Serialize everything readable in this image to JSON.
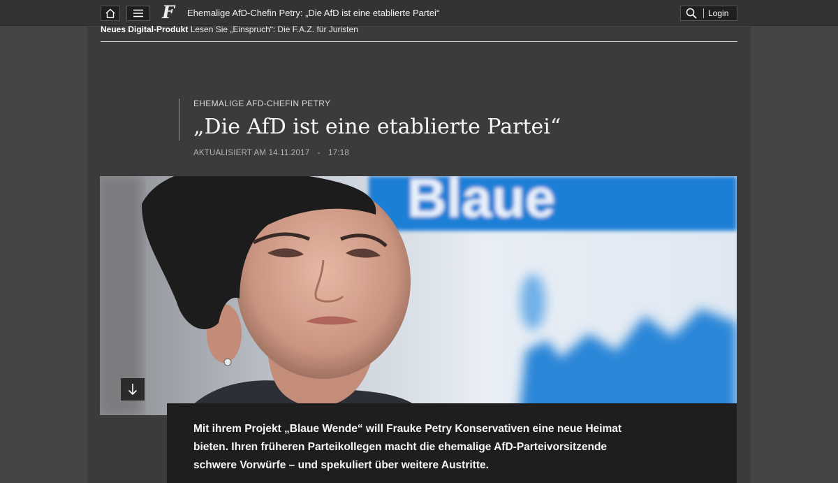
{
  "topbar": {
    "home_icon": "home-icon",
    "menu_icon": "menu-icon",
    "logo_text": "F",
    "title": "Ehemalige AfD-Chefin Petry: „Die AfD ist eine etablierte Partei“",
    "search_icon": "search-icon",
    "login_label": "Login"
  },
  "promo": {
    "label": "Neues Digital-Produkt",
    "text": "Lesen Sie „Einspruch“: Die F.A.Z. für Juristen"
  },
  "article": {
    "kicker": "EHEMALIGE AFD-CHEFIN PETRY",
    "headline": "„Die AfD ist eine etablierte Partei“",
    "updated_label": "AKTUALISIERT AM 14.11.2017",
    "updated_sep": "-",
    "updated_time": "17:18",
    "hero_banner_text": "Blaue",
    "teaser": "Mit ihrem Projekt „Blaue Wende“ will Frauke Petry Konservativen eine neue Heimat bieten. Ihren früheren Parteikollegen macht die ehemalige AfD-Parteivorsitzende schwere Vorwürfe – und spekuliert über weitere Austritte."
  },
  "colors": {
    "page_bg": "#454545",
    "column_bg": "#3b3b3b",
    "topbar_bg": "#333333",
    "teaser_bg": "#1e1e1e",
    "banner_blue": "#1f7fd6"
  }
}
